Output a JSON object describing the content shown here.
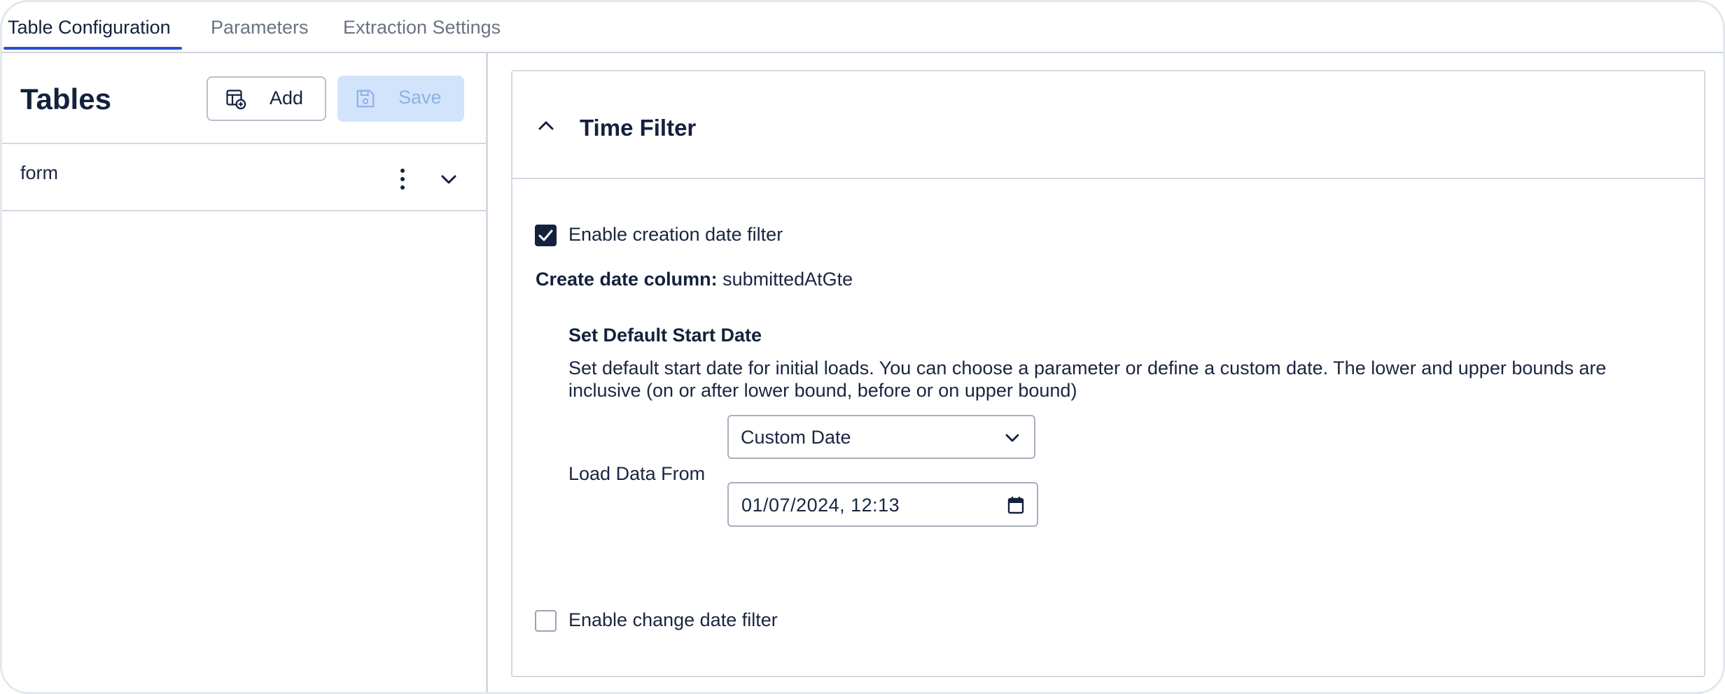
{
  "tabs": [
    {
      "label": "Table Configuration",
      "active": true
    },
    {
      "label": "Parameters",
      "active": false
    },
    {
      "label": "Extraction Settings",
      "active": false
    }
  ],
  "left": {
    "title": "Tables",
    "add_label": "Add",
    "save_label": "Save",
    "tables": [
      {
        "name": "form"
      }
    ]
  },
  "time_filter": {
    "title": "Time Filter",
    "creation_filter": {
      "label": "Enable creation date filter",
      "checked": true
    },
    "create_column_label": "Create date column:",
    "create_column_value": "submittedAtGte",
    "start_date": {
      "title": "Set Default Start Date",
      "description": "Set default start date for initial loads. You can choose a parameter or define a custom date. The lower and upper bounds are inclusive (on or after lower bound, before or on upper bound)",
      "load_label": "Load Data From",
      "select_value": "Custom Date",
      "date_value": "01/07/2024, 12:13"
    },
    "change_filter": {
      "label": "Enable change date filter",
      "checked": false
    }
  },
  "colors": {
    "accent": "#2b4fd0",
    "text": "#14213d",
    "save_bg": "#d2e4fb",
    "border": "#d3d8e2"
  },
  "icons": [
    "table-add-icon",
    "save-icon",
    "kebab-menu-icon",
    "chevron-down-icon",
    "chevron-up-icon",
    "check-icon",
    "calendar-icon"
  ]
}
